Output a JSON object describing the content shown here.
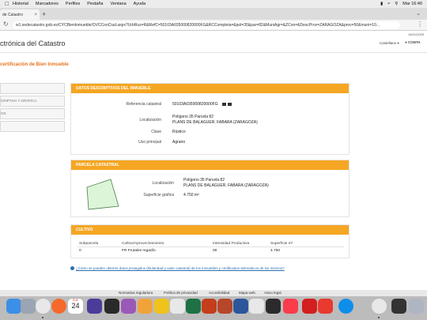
{
  "menubar": {
    "items": [
      "Historial",
      "Marcadores",
      "Perfiles",
      "Pestaña",
      "Ventana",
      "Ayuda"
    ],
    "clock": "Mar 16:40"
  },
  "tab": {
    "title": "de Catastro"
  },
  "toolbar": {
    "url": "w1.sedecatastro.gob.es/CYCBienInmueble/OVCConCiud.aspx?UrbRus=R&RefC=50103A035000820000FG&RCCompleta=&pol=35&par=82&MuniAgr=&ZCon=&DescProv=ZARAGOZA&prov=50&muni=10..."
  },
  "page": {
    "site_title": "ctrónica del Catastro",
    "datestamp": "14/01/2025",
    "language": "Castellano",
    "contact": "CONTA",
    "heading": "certificación de Bien Inmueble",
    "sidenav": [
      "",
      "CRIPTIVA Y GRÁFICA",
      "OS",
      ""
    ]
  },
  "panel1": {
    "header": "DATOS DESCRIPTIVOS DEL INMUEBLE",
    "ref_label": "Referencia catastral",
    "ref_value": "50103A035000820000FG",
    "loc_label": "Localización",
    "loc_line1": "Polígono 35 Parcela 82",
    "loc_line2": "PLANS DE BALAGUER. FABARA (ZARAGOZA)",
    "class_label": "Clase",
    "class_value": "Rústico",
    "use_label": "Uso principal",
    "use_value": "Agrario"
  },
  "panel2": {
    "header": "PARCELA CATASTRAL",
    "loc_label": "Localización",
    "loc_line1": "Polígono 35 Parcela 82",
    "loc_line2": "PLANS DE BALAGUER. FABARA (ZARAGOZA)",
    "area_label": "Superficie gráfica",
    "area_value": "4.750 m²"
  },
  "panel3": {
    "header": "CULTIVO",
    "columns": [
      "Subparcela",
      "Cultivo/Aprovechamiento",
      "Intensidad Productiva",
      "Superficie m²"
    ],
    "rows": [
      [
        "0",
        "FR Frutales regadío",
        "00",
        "4.750"
      ]
    ]
  },
  "link": "¿Cómo se pueden obtener datos protegidos (titularidad y valor catastral) de los inmuebles y certificados telemáticos de los mismos?",
  "footer": [
    "Normativa reguladora",
    "Política de privacidad",
    "Accesibilidad",
    "Mapa web",
    "Aviso legal"
  ],
  "dock": {
    "calendar_month": "ENE",
    "calendar_day": "24",
    "colors": {
      "finder": "#3b8fe6",
      "launchpad": "#9aa4b2",
      "chrome": "#e8e8e8",
      "firefox": "#f56a2c",
      "badge": "#e53935",
      "calendar": "#ffffff",
      "star": "#4c3c9a",
      "keynote": "#2a2a2a",
      "excel": "#1e7145",
      "powerpoint": "#c43e1c",
      "ppt2": "#b7472a",
      "word": "#2b579a",
      "photos": "#e8e8e8",
      "plugin": "#f0c21c",
      "music": "#fa3c4c",
      "acrobat": "#d31f1f",
      "acrobat2": "#e83a2f",
      "teamviewer": "#0e8ee9",
      "chrome2": "#e8e8e8",
      "quicktime": "#333333",
      "preview": "#aeb6c4"
    }
  }
}
